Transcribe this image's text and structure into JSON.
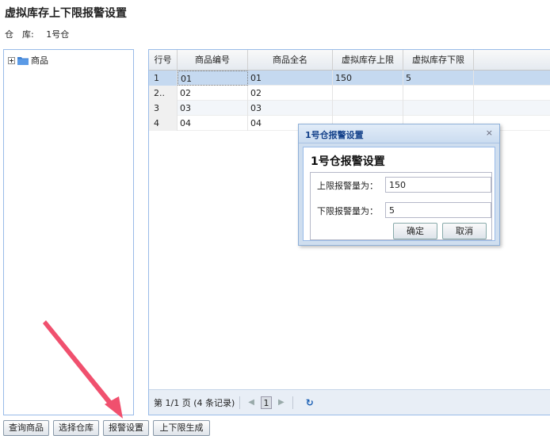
{
  "page": {
    "title": "虚拟库存上下限报警设置",
    "warehouse_label": "仓　库:",
    "warehouse_value": "1号仓"
  },
  "tree": {
    "root_label": "商品",
    "root_icon": "folder-icon"
  },
  "grid": {
    "columns": [
      "行号",
      "商品编号",
      "商品全名",
      "虚拟库存上限",
      "虚拟库存下限"
    ],
    "rows": [
      [
        "1",
        "01",
        "01",
        "150",
        "5"
      ],
      [
        "2..",
        "02",
        "02",
        "",
        ""
      ],
      [
        "3",
        "03",
        "03",
        "",
        ""
      ],
      [
        "4",
        "04",
        "04",
        "",
        ""
      ]
    ]
  },
  "pager": {
    "info": "第 1/1 页 (4 条记录)",
    "current_page": "1",
    "prev_icon": "◀",
    "next_icon": "▶",
    "refresh_icon": "↻"
  },
  "dialog": {
    "title": "1号仓报警设置",
    "heading": "1号仓报警设置",
    "close_icon": "×",
    "upper_label": "上限报警量为：",
    "upper_value": "150",
    "lower_label": "下限报警量为：",
    "lower_value": "5",
    "ok_label": "确定",
    "cancel_label": "取消"
  },
  "toolbar": {
    "query_label": "查询商品",
    "select_warehouse_label": "选择仓库",
    "alarm_settings_label": "报警设置",
    "generate_label": "上下限生成"
  },
  "colors": {
    "panel_border": "#99bbe8",
    "selected_row": "#c5d9f0",
    "dialog_title": "#15428b",
    "annotation_arrow": "#f0506e"
  }
}
